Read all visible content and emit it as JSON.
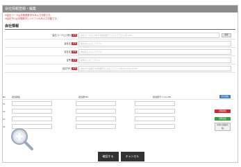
{
  "title": "会社情報登録・編集",
  "notes": [
    "※会社コードは半角英数字のみ入力可能です。",
    "※会社TELは半角数字とハイフンのみ入力可能です。"
  ],
  "section_title": "会社情報",
  "required_badge": "必須",
  "search_button": "検索",
  "fields": [
    {
      "label": "会社コード(上3桁)",
      "placeholder": "会社コードの上3桁を半角英数字で入力して下さい(例:A03)"
    },
    {
      "label": "会社名",
      "placeholder": "会社名を入力して下さい"
    },
    {
      "label": "支社名",
      "placeholder": "支社名を入力して下さい"
    },
    {
      "label": "住所",
      "placeholder": "住所を入力して下さい"
    },
    {
      "label": "会社TEL",
      "placeholder": "会社の代表番号を半角数字で入力して下さい(例:03-1234-5678)"
    }
  ],
  "contacts": {
    "headers": {
      "no": "No",
      "name": "担当者名",
      "tel": "担当者TEL",
      "mobile": "担当者モバイルTEL"
    },
    "add_button": "担当追加",
    "rows": [
      {
        "num": "01"
      },
      {
        "num": "02",
        "action": "削除削除"
      },
      {
        "num": "03",
        "action": "削除追加"
      },
      {
        "num": "04",
        "action": "担当の追加(有効)"
      }
    ]
  },
  "footer": {
    "confirm": "確認する",
    "cancel": "キャンセル"
  },
  "icons": {
    "zoom": "magnifier-plus-icon"
  },
  "colors": {
    "titlebar": "#8a8a8a",
    "required": "#d6262c",
    "primary": "#3a7fd0",
    "success": "#3aa03a",
    "dark": "#333333"
  }
}
